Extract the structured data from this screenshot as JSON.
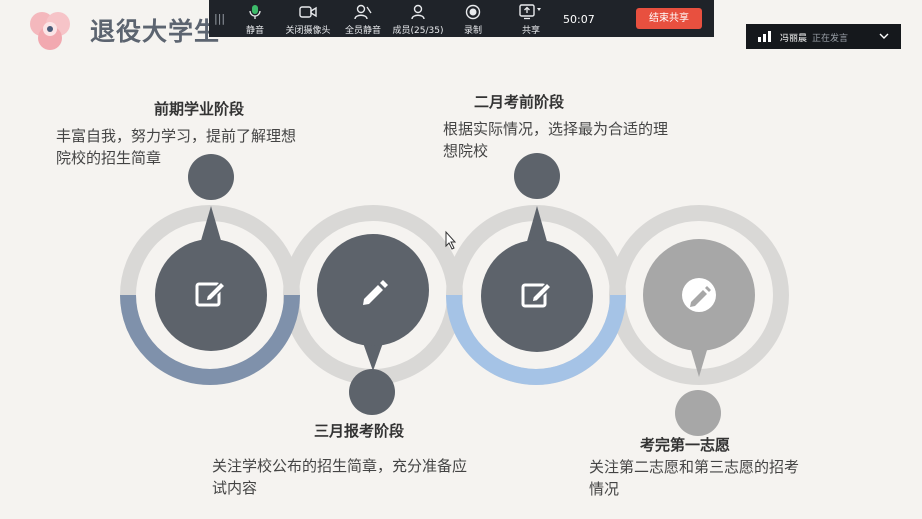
{
  "slide": {
    "title": "退役大学生"
  },
  "toolbar": {
    "items": [
      {
        "icon": "microphone-icon",
        "label": "静音"
      },
      {
        "icon": "camera-icon",
        "label": "关闭摄像头"
      },
      {
        "icon": "mute-all-icon",
        "label": "全员静音"
      },
      {
        "icon": "members-icon",
        "label": "成员(25/35)"
      },
      {
        "icon": "record-icon",
        "label": "录制"
      },
      {
        "icon": "share-screen-icon",
        "label": "共享"
      }
    ],
    "timer": "50:07",
    "end_button": "结束共享"
  },
  "speaker": {
    "name": "冯丽晨",
    "status": "正在发言"
  },
  "stages": [
    {
      "title": "前期学业阶段",
      "desc_line1": "丰富自我，努力学习，提前了解理想",
      "desc_line2": "院校的招生简章",
      "icon": "edit-square-icon"
    },
    {
      "title": "三月报考阶段",
      "desc_line1": "关注学校公布的招生简章，充分准备应",
      "desc_line2": "试内容",
      "icon": "pencil-icon"
    },
    {
      "title": "二月考前阶段",
      "desc_line1": "根据实际情况，选择最为合适的理",
      "desc_line2": "想院校",
      "icon": "edit-square-icon"
    },
    {
      "title": "考完第一志愿",
      "desc_line1": "关注第二志愿和第三志愿的招考",
      "desc_line2": "情况",
      "icon": "pencil-circle-icon"
    }
  ],
  "colors": {
    "dark_circle": "#5d636b",
    "grey_circle": "#a7a7a7",
    "ring_light": "#d9d8d6",
    "arc_steel": "#7f91ab",
    "arc_blue": "#a5c3e6",
    "end_button": "#e8503f"
  }
}
